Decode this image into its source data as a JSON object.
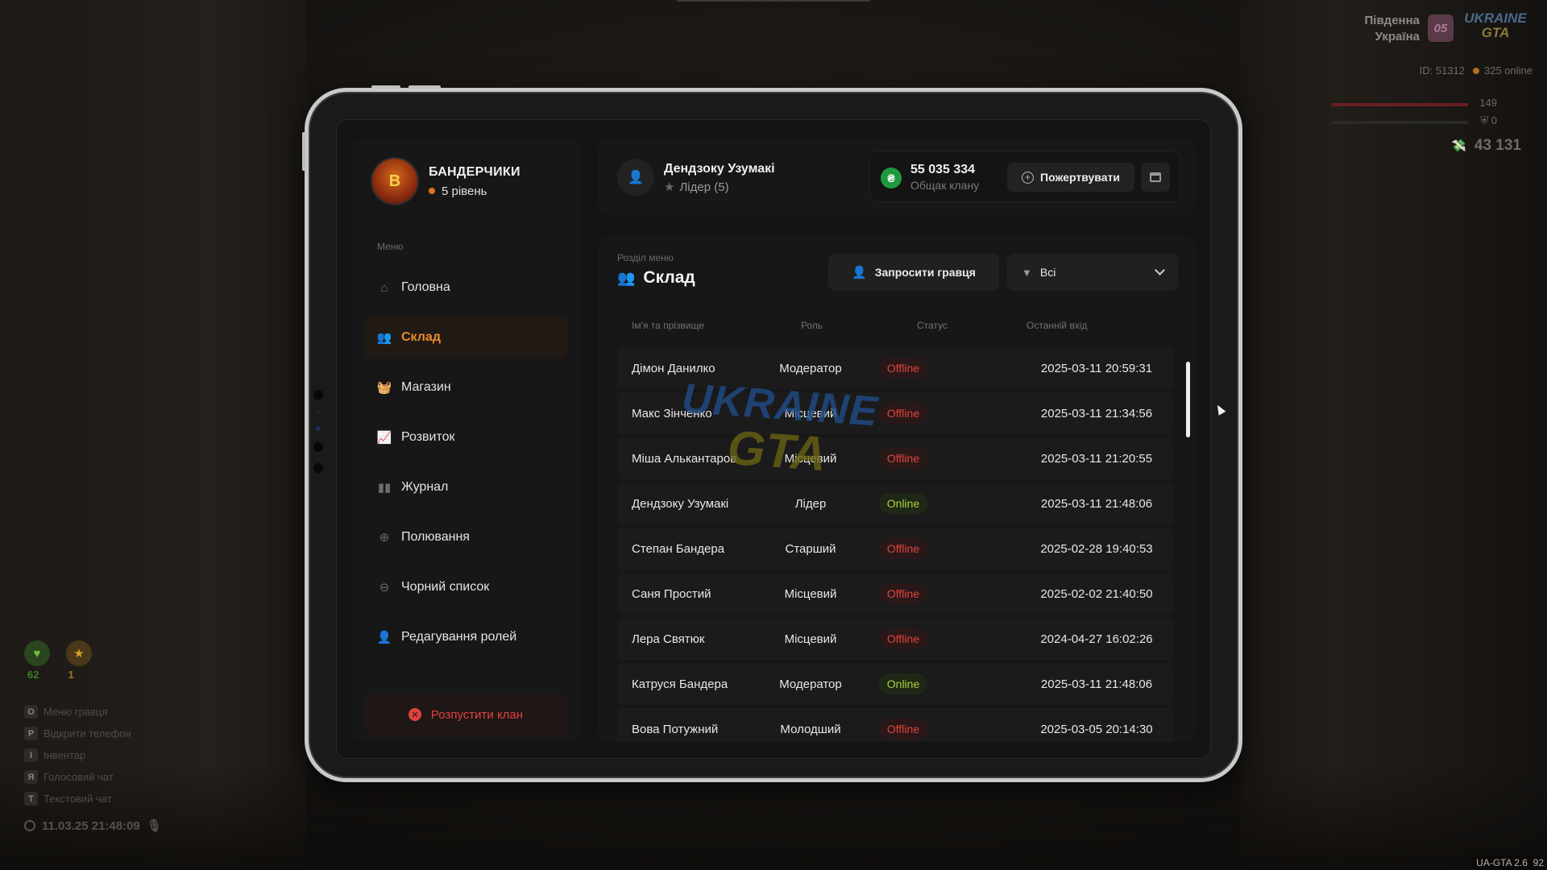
{
  "hud": {
    "server_line1": "Південна",
    "server_line2": "Україна",
    "server_number": "05",
    "brand_line1": "UKRAINE",
    "brand_line2": "GTA",
    "id_text": "ID: 51312",
    "online_text": "325 online",
    "health": "149",
    "armor": "0",
    "money": "43 131",
    "stat_green": "62",
    "stat_orange": "1",
    "keys": [
      {
        "key": "O",
        "label": "Меню гравця"
      },
      {
        "key": "P",
        "label": "Відкрити телефон"
      },
      {
        "key": "I",
        "label": "Інвентар"
      },
      {
        "key": "Я",
        "label": "Голосовий чат"
      },
      {
        "key": "T",
        "label": "Текстовий чат"
      }
    ],
    "datetime": "11.03.25 21:48:09",
    "version": "UA-GTA 2.6",
    "fps": "92"
  },
  "clan": {
    "name": "БАНДЕРЧИКИ",
    "level": "5 рівень",
    "logo_text": "B"
  },
  "menu": {
    "caption": "Меню",
    "items": [
      {
        "label": "Головна",
        "icon": "home-icon",
        "glyph": "⌂"
      },
      {
        "label": "Склад",
        "icon": "members-icon",
        "glyph": "👥"
      },
      {
        "label": "Магазин",
        "icon": "basket-icon",
        "glyph": "🧺"
      },
      {
        "label": "Розвиток",
        "icon": "chart-icon",
        "glyph": "📈"
      },
      {
        "label": "Журнал",
        "icon": "book-icon",
        "glyph": "▮▮"
      },
      {
        "label": "Полювання",
        "icon": "crosshair-icon",
        "glyph": "⊕"
      },
      {
        "label": "Чорний список",
        "icon": "block-icon",
        "glyph": "⊖"
      },
      {
        "label": "Редагування ролей",
        "icon": "user-edit-icon",
        "glyph": "👤"
      }
    ],
    "active_index": 1,
    "disband_label": "Розпустити клан"
  },
  "user": {
    "name": "Дендзоку Узумакі",
    "role": "Лідер (5)"
  },
  "bank": {
    "icon_glyph": "₴",
    "amount": "55 035 334",
    "caption": "Общак клану",
    "donate_label": "Пожертвувати"
  },
  "section": {
    "caption": "Розділ меню",
    "title": "Склад",
    "invite_label": "Запросити гравця",
    "filter_value": "Всі"
  },
  "table": {
    "headers": [
      "Ім'я та прізвище",
      "Роль",
      "Статус",
      "Останній вхід"
    ],
    "rows": [
      {
        "name": "Дімон Данилко",
        "role": "Модератор",
        "status": "Offline",
        "online": false,
        "last": "2025-03-11 20:59:31"
      },
      {
        "name": "Макс Зінченко",
        "role": "Місцевий",
        "status": "Offline",
        "online": false,
        "last": "2025-03-11 21:34:56"
      },
      {
        "name": "Міша Алькантаров",
        "role": "Місцевий",
        "status": "Offline",
        "online": false,
        "last": "2025-03-11 21:20:55"
      },
      {
        "name": "Дендзоку Узумакі",
        "role": "Лідер",
        "status": "Online",
        "online": true,
        "last": "2025-03-11 21:48:06"
      },
      {
        "name": "Степан Бандера",
        "role": "Старший",
        "status": "Offline",
        "online": false,
        "last": "2025-02-28 19:40:53"
      },
      {
        "name": "Саня Простий",
        "role": "Місцевий",
        "status": "Offline",
        "online": false,
        "last": "2025-02-02 21:40:50"
      },
      {
        "name": "Лера Святюк",
        "role": "Місцевий",
        "status": "Offline",
        "online": false,
        "last": "2024-04-27 16:02:26"
      },
      {
        "name": "Катруся Бандера",
        "role": "Модератор",
        "status": "Online",
        "online": true,
        "last": "2025-03-11 21:48:06"
      },
      {
        "name": "Вова Потужний",
        "role": "Молодший",
        "status": "Offline",
        "online": false,
        "last": "2025-03-05 20:14:30"
      }
    ]
  },
  "watermark": {
    "line1": "UKRAINE",
    "line2": "GTA"
  },
  "colors": {
    "accent": "#e88a2e",
    "offline": "#e0433e",
    "online": "#a9d13a",
    "bank": "#1f9a3e"
  }
}
